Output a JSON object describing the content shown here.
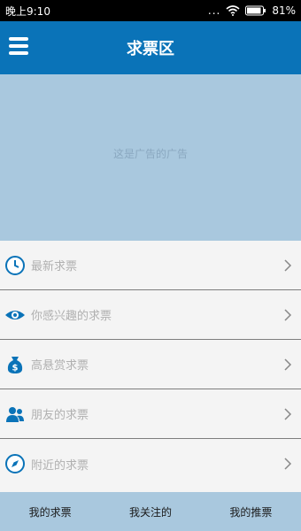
{
  "status": {
    "time": "晚上9:10",
    "dots": "...",
    "battery": "81%"
  },
  "header": {
    "title": "求票区"
  },
  "ad": {
    "text": "这是广告的广告"
  },
  "menu": {
    "items": [
      {
        "label": "最新求票",
        "icon": "clock-icon"
      },
      {
        "label": "你感兴趣的求票",
        "icon": "eye-icon"
      },
      {
        "label": "高悬赏求票",
        "icon": "money-bag-icon"
      },
      {
        "label": "朋友的求票",
        "icon": "friends-icon"
      },
      {
        "label": "附近的求票",
        "icon": "compass-icon"
      }
    ]
  },
  "tabs": [
    "我的求票",
    "我关注的",
    "我的推票"
  ],
  "colors": {
    "accent": "#0a73b8",
    "light_blue": "#a9c8de"
  }
}
